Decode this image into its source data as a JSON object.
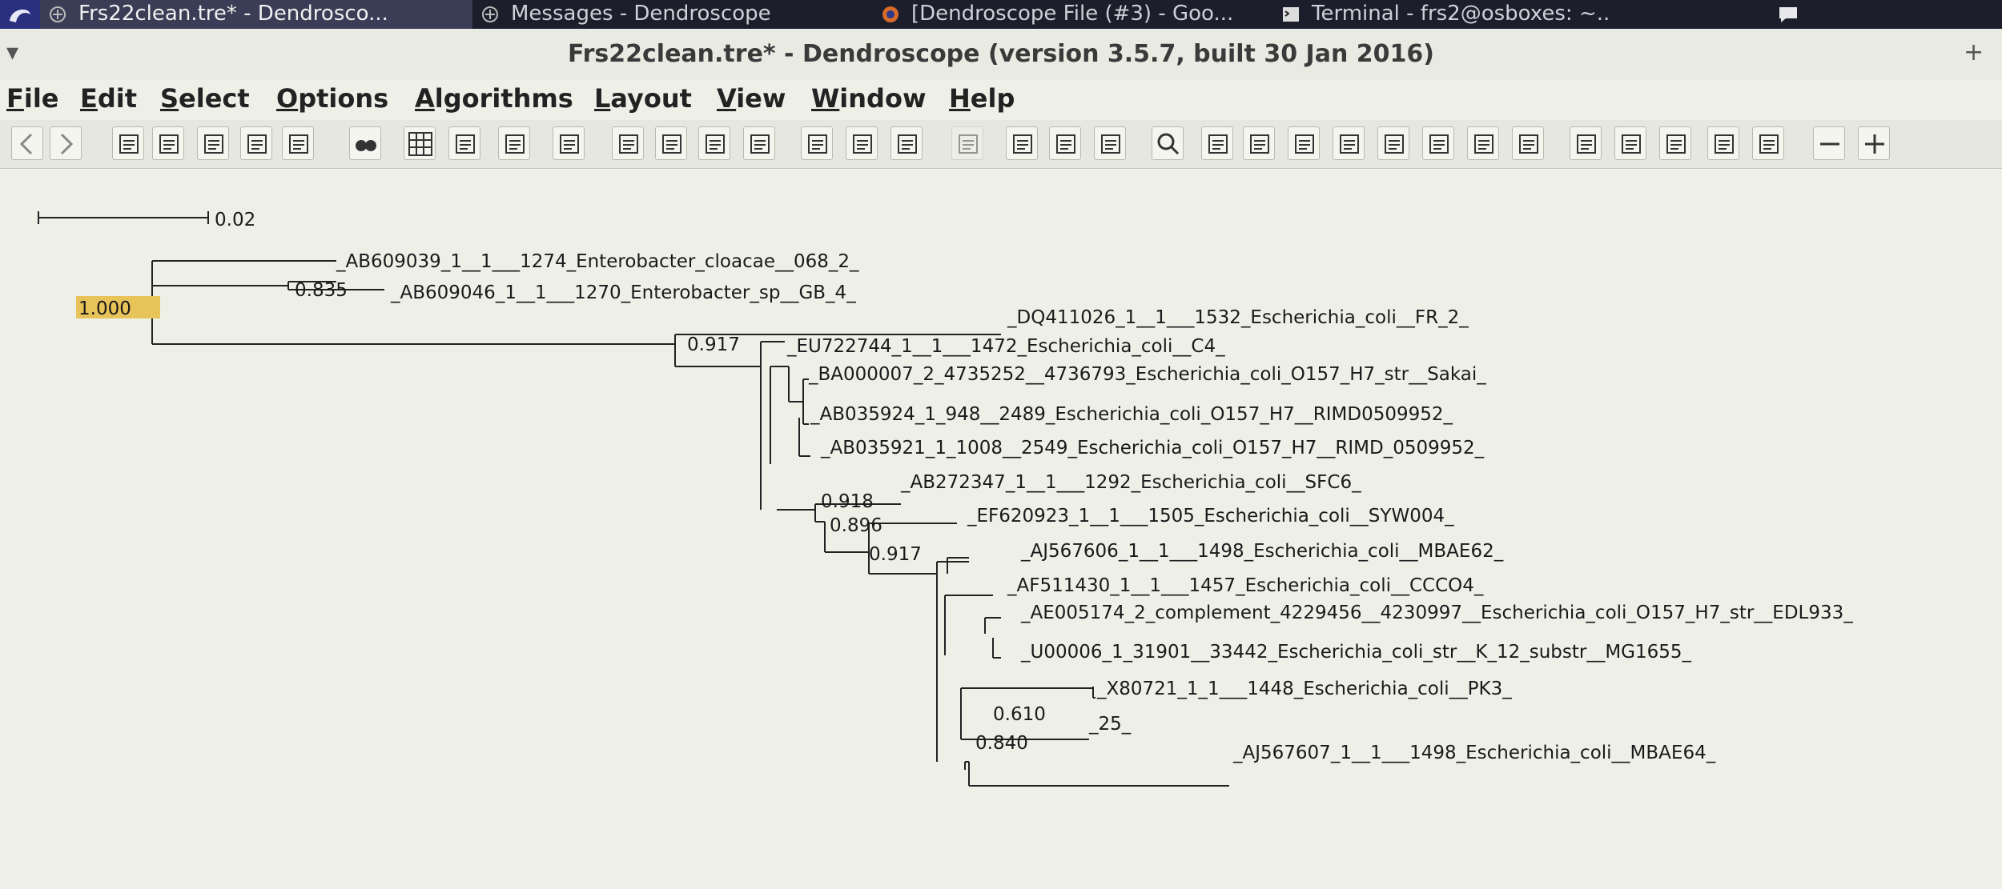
{
  "taskbar": {
    "tasks": [
      {
        "label": "Frs22clean.tre* - Dendrosco...",
        "active": true
      },
      {
        "label": "Messages - Dendroscope",
        "active": false
      },
      {
        "label": "[Dendroscope File (#3) - Goo...",
        "active": false
      },
      {
        "label": "Terminal - frs2@osboxes: ~...",
        "active": false
      }
    ]
  },
  "window": {
    "title": "Frs22clean.tre* - Dendroscope (version 3.5.7, built 30 Jan 2016)",
    "menu_button": "▾",
    "maximize_button": "+"
  },
  "menubar": [
    {
      "mnemonic": "F",
      "rest": "ile"
    },
    {
      "mnemonic": "E",
      "rest": "dit"
    },
    {
      "mnemonic": "S",
      "rest": "elect"
    },
    {
      "mnemonic": "O",
      "rest": "ptions"
    },
    {
      "mnemonic": "A",
      "rest": "lgorithms"
    },
    {
      "mnemonic": "L",
      "rest": "ayout"
    },
    {
      "mnemonic": "V",
      "rest": "iew"
    },
    {
      "mnemonic": "W",
      "rest": "indow"
    },
    {
      "mnemonic": "H",
      "rest": "elp"
    }
  ],
  "toolbar_icons": [
    "back-icon",
    "forward-icon",
    "open-icon",
    "properties-icon",
    "save-icon",
    "print-icon",
    "export-icon",
    "find-icon",
    "grid-icon",
    "single-view-icon",
    "page-icon",
    "list-icon",
    "expand-vertical-icon",
    "contract-vertical-icon",
    "expand-horizontal-icon",
    "contract-horizontal-icon",
    "rotate-left-icon",
    "rotate-right-icon",
    "flip-icon",
    "disabled-icon",
    "zoom-fit-icon",
    "rows-icon",
    "columns-icon",
    "magnify-icon",
    "rectangular-phylogram-icon",
    "rectangular-cladogram-icon",
    "slanted-cladogram-icon",
    "unrooted-icon",
    "circular-phylogram-icon",
    "circular-cladogram-icon",
    "radial-icon",
    "radial-cladogram-icon",
    "left-ladderize-icon",
    "right-ladderize-icon",
    "random-ladderize-icon",
    "indent-icon",
    "label-icon",
    "minus-icon",
    "plus-icon"
  ],
  "tree": {
    "scale_label": "0.02",
    "root_support": "1.000",
    "supports": [
      "0.835",
      "0.917",
      "0.918",
      "0.896",
      "0.917",
      "0.610",
      "0.840"
    ],
    "taxa": [
      "_AB609039_1__1___1274_Enterobacter_cloacae__068_2_",
      "_AB609046_1__1___1270_Enterobacter_sp__GB_4_",
      "_DQ411026_1__1___1532_Escherichia_coli__FR_2_",
      "_EU722744_1__1___1472_Escherichia_coli__C4_",
      "_BA000007_2_4735252__4736793_Escherichia_coli_O157_H7_str__Sakai_",
      "_AB035924_1_948__2489_Escherichia_coli_O157_H7__RIMD0509952_",
      "_AB035921_1_1008__2549_Escherichia_coli_O157_H7__RIMD_0509952_",
      "_AB272347_1__1___1292_Escherichia_coli__SFC6_",
      "_EF620923_1__1___1505_Escherichia_coli__SYW004_",
      "_AJ567606_1__1___1498_Escherichia_coli__MBAE62_",
      "_AF511430_1__1___1457_Escherichia_coli__CCCO4_",
      "_AE005174_2_complement_4229456__4230997__Escherichia_coli_O157_H7_str__EDL933_",
      "_U00006_1_31901__33442_Escherichia_coli_str__K_12_substr__MG1655_",
      "_X80721_1_1___1448_Escherichia_coli__PK3_",
      "_25_",
      "_AJ567607_1__1___1498_Escherichia_coli__MBAE64_"
    ]
  },
  "colors": {
    "selection": "#e8c35a",
    "branch": "#222222"
  }
}
